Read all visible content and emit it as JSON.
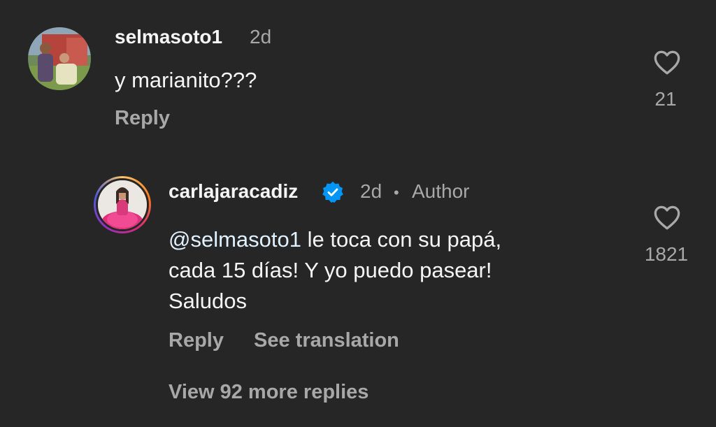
{
  "comment": {
    "username": "selmasoto1",
    "time": "2d",
    "text": "y marianito???",
    "reply_label": "Reply",
    "like_count": "21"
  },
  "reply": {
    "username": "carlajaracadiz",
    "time": "2d",
    "separator": "•",
    "author_label": "Author",
    "mention": "@selmasoto1",
    "text_line1": " le toca con su papá,",
    "text_line2": "cada 15 días! Y yo puedo pasear!",
    "text_line3": "Saludos",
    "reply_label": "Reply",
    "translate_label": "See translation",
    "like_count": "1821"
  },
  "view_more": "View 92 more replies",
  "colors": {
    "background": "#262626",
    "primary_text": "#f5f5f5",
    "secondary_text": "#a8a8a8",
    "verified": "#0095f6"
  },
  "icons": [
    "heart-icon",
    "verified-badge-icon"
  ]
}
